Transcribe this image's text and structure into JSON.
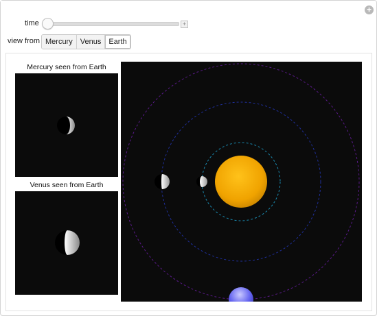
{
  "controls": {
    "time_label": "time",
    "view_from_label": "view from",
    "view_options": [
      "Mercury",
      "Venus",
      "Earth"
    ],
    "selected_view": "Earth",
    "time_value_fraction": 0.0
  },
  "panels": {
    "mercury_title": "Mercury seen from Earth",
    "venus_title": "Venus seen from Earth"
  },
  "colors": {
    "sun": "#f4a900",
    "earth": "#6c6cff",
    "mercury_orbit": "#1a8ab0",
    "venus_orbit": "#1f2f9a",
    "earth_orbit": "#5a1a8a",
    "background": "#0b0b0b"
  },
  "icons": {
    "corner_plus": "plus-circle-icon",
    "slider_plus": "plus-icon"
  }
}
